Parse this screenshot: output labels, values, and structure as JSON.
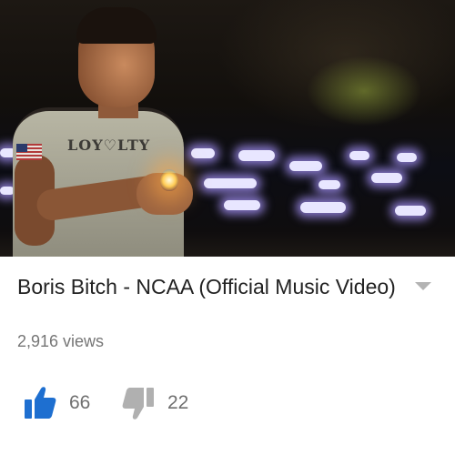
{
  "video": {
    "title": "Boris Bitch - NCAA (Official Music Video)",
    "views": "2,916 views",
    "shirt_text": "LOY♡LTY"
  },
  "actions": {
    "like_count": "66",
    "dislike_count": "22",
    "like_icon": "thumbs-up-icon",
    "dislike_icon": "thumbs-down-icon",
    "expand_icon": "expand-description-icon"
  },
  "colors": {
    "accent": "#1e6fd0",
    "title": "#222222",
    "meta": "#767676",
    "icon_inactive": "#b0b0b0"
  }
}
